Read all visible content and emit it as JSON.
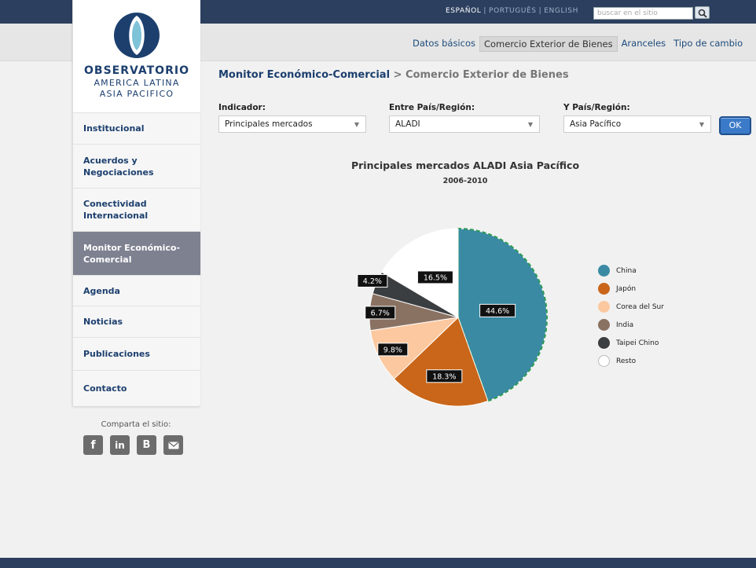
{
  "header": {
    "languages": [
      "ESPAÑOL",
      "PORTUGUÊS",
      "ENGLISH"
    ],
    "active_language": "ESPAÑOL",
    "search_placeholder": "buscar en el sitio"
  },
  "top_nav": [
    {
      "label": "Datos básicos",
      "active": false
    },
    {
      "label": "Comercio Exterior de Bienes",
      "active": true
    },
    {
      "label": "Aranceles",
      "active": false
    },
    {
      "label": "Tipo de cambio",
      "active": false
    }
  ],
  "logo": {
    "title": "OBSERVATORIO",
    "line1": "AMERICA LATINA",
    "line2": "ASIA PACIFICO"
  },
  "sidebar": {
    "items": [
      {
        "label": "Institucional",
        "active": false
      },
      {
        "label": "Acuerdos y Negociaciones",
        "active": false
      },
      {
        "label": "Conectividad Internacional",
        "active": false
      },
      {
        "label": "Monitor Económico-Comercial",
        "active": true
      },
      {
        "label": "Agenda",
        "active": false
      },
      {
        "label": "Noticias",
        "active": false
      },
      {
        "label": "Publicaciones",
        "active": false
      },
      {
        "label": "Contacto",
        "active": false
      }
    ],
    "share_label": "Comparta el sitio:",
    "social_icons": [
      "facebook-icon",
      "linkedin-icon",
      "blogger-icon",
      "mail-icon"
    ]
  },
  "breadcrumb": {
    "main": "Monitor Económico-Comercial",
    "separator": ">",
    "current": "Comercio Exterior de Bienes"
  },
  "filters": {
    "indicador_label": "Indicador:",
    "indicador_value": "Principales mercados",
    "entre_label": "Entre País/Región:",
    "entre_value": "ALADI",
    "y_label": "Y País/Región:",
    "y_value": "Asia Pacífico",
    "ok_label": "OK"
  },
  "chart_data": {
    "type": "pie",
    "title": "Principales mercados ALADI Asia Pacífico",
    "subtitle": "2006-2010",
    "slices": [
      {
        "name": "China",
        "value": 44.6,
        "label": "44.6%",
        "color": "#3a8aa4",
        "highlighted": true
      },
      {
        "name": "Japón",
        "value": 18.3,
        "label": "18.3%",
        "color": "#c9661a"
      },
      {
        "name": "Corea del Sur",
        "value": 9.8,
        "label": "9.8%",
        "color": "#fcc89f"
      },
      {
        "name": "India",
        "value": 6.7,
        "label": "6.7%",
        "color": "#8a7263"
      },
      {
        "name": "Taipei Chino",
        "value": 4.2,
        "label": "4.2%",
        "color": "#3b3e40"
      },
      {
        "name": "Resto",
        "value": 16.5,
        "label": "16.5%",
        "color": "#ffffff"
      }
    ],
    "legend_position": "right"
  }
}
